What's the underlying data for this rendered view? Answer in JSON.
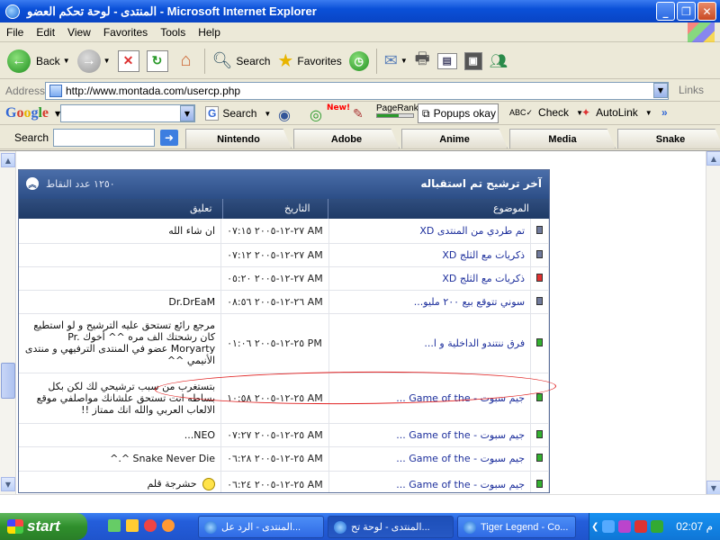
{
  "window": {
    "title": "المنتدى - لوحة تحكم العضو - Microsoft Internet Explorer"
  },
  "menu": [
    "File",
    "Edit",
    "View",
    "Favorites",
    "Tools",
    "Help"
  ],
  "toolbar": {
    "back_label": "Back",
    "search_label": "Search",
    "favorites_label": "Favorites"
  },
  "address": {
    "label": "Address",
    "url": "http://www.montada.com/usercp.php",
    "links_label": "Links"
  },
  "google": {
    "logo": "Google",
    "search_label": "Search",
    "new_badge": "New!",
    "pagerank_label": "PageRank",
    "popups_label": "Popups okay",
    "check_label": "Check",
    "autolink_label": "AutoLink",
    "more": "»"
  },
  "linksbar": {
    "search_label": "Search",
    "tabs": [
      "Nintendo",
      "Adobe",
      "Anime",
      "Media",
      "Snake"
    ]
  },
  "panel": {
    "title": "آخر ترشيح تم استقباله",
    "points": "١٢٥٠ عدد النقاط",
    "columns": {
      "topic": "الموضوع",
      "date": "التاريخ",
      "comment": "تعليق"
    },
    "rows": [
      {
        "icon": "grey",
        "topic": "تم طردي من المنتدى XD",
        "date": "٢٧-١٢-٢٠٠٥ ٠٧:١٥ AM",
        "comment": "ان شاء الله"
      },
      {
        "icon": "grey",
        "topic": "ذكريات مع الثلج XD",
        "date": "٢٧-١٢-٢٠٠٥ ٠٧:١٢ AM",
        "comment": ""
      },
      {
        "icon": "red",
        "topic": "ذكريات مع الثلج XD",
        "date": "٢٧-١٢-٢٠٠٥ ٠٥:٢٠ AM",
        "comment": ""
      },
      {
        "icon": "grey",
        "topic": "سوني تتوقع بيع ٢٠٠ مليو...",
        "date": "٢٦-١٢-٢٠٠٥ ٠٨:٥٦ AM",
        "comment": "Dr.DrEaM"
      },
      {
        "icon": "green",
        "topic": "فرق ننتندو الداخلية و ا...",
        "date": "٢٥-١٢-٢٠٠٥ ٠١:٠٦ PM",
        "comment": "مرجع رائع تستحق عليه الترشيح و لو استطيع كان رشحتك الف مره ^^ أخوك Pr. Moryarty عضو في المنتدى الترفيهي و منتدى الأنيمي ^^"
      },
      {
        "icon": "green",
        "topic": "جيم سبوت - Game of the ...",
        "date": "٢٥-١٢-٢٠٠٥ ١٠:٥٨ AM",
        "comment": "بتستغرب من سبب ترشيحي لك لكن بكل بساطه انت تستحق علشانك مواصلفي موقع الالعاب العربي والله انك ممتاز !!"
      },
      {
        "icon": "green",
        "topic": "جيم سبوت - Game of the ...",
        "date": "٢٥-١٢-٢٠٠٥ ٠٧:٢٧ AM",
        "comment": "NEO..."
      },
      {
        "icon": "green",
        "topic": "جيم سبوت - Game of the ...",
        "date": "٢٥-١٢-٢٠٠٥ ٠٦:٢٨ AM",
        "comment": "Snake Never Die ^.^"
      },
      {
        "icon": "green",
        "topic": "جيم سبوت - Game of the ...",
        "date": "٢٥-١٢-٢٠٠٥ ٠٦:٢٤ AM",
        "comment": "حشرجة قلم"
      }
    ]
  },
  "taskbar": {
    "start_label": "start",
    "tasks": [
      {
        "label": "المنتدى - الرد عل...",
        "active": false
      },
      {
        "label": "المنتدى - لوحة تح...",
        "active": true
      },
      {
        "label": "Tiger Legend - Co...",
        "active": false
      }
    ],
    "clock": "02:07 م"
  }
}
